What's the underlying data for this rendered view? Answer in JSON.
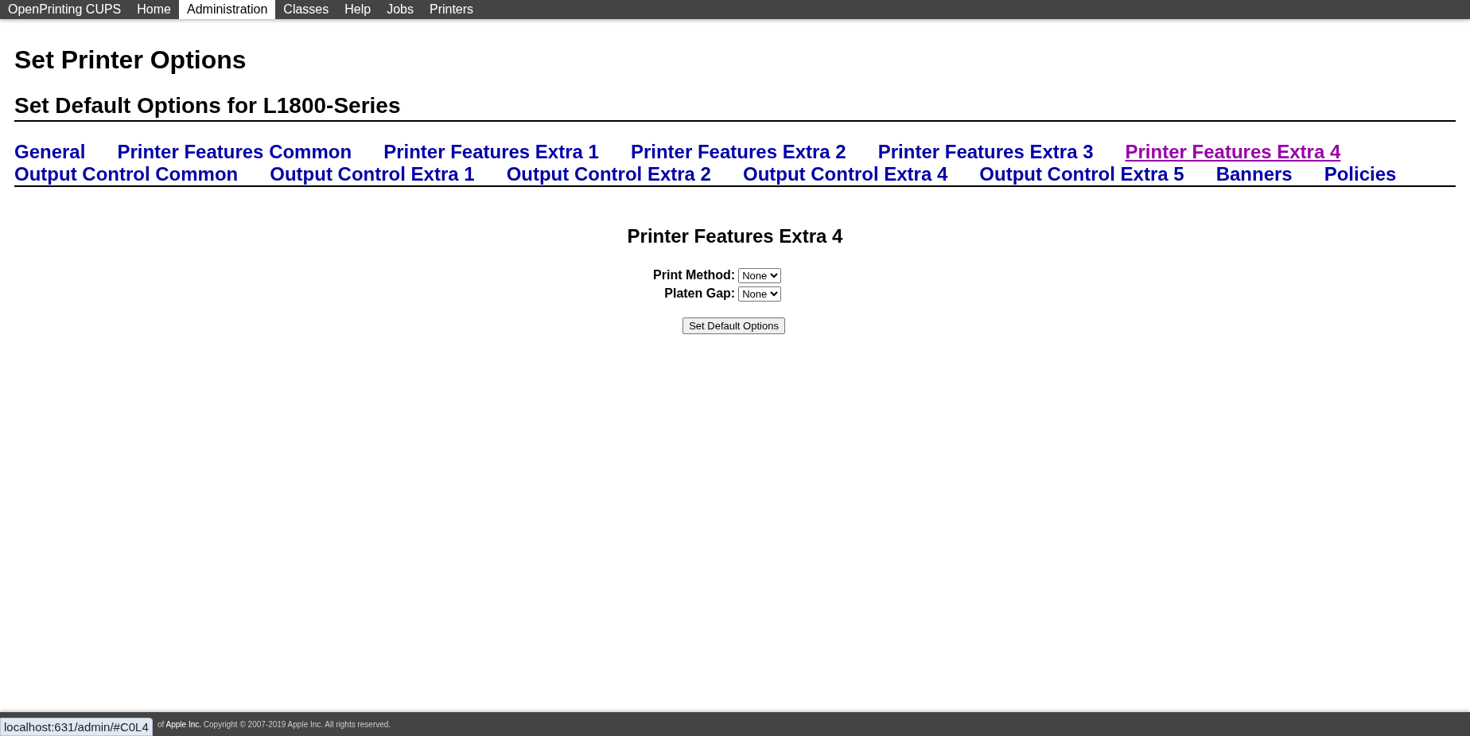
{
  "nav": [
    {
      "label": "OpenPrinting CUPS",
      "selected": false
    },
    {
      "label": "Home",
      "selected": false
    },
    {
      "label": "Administration",
      "selected": true
    },
    {
      "label": "Classes",
      "selected": false
    },
    {
      "label": "Help",
      "selected": false
    },
    {
      "label": "Jobs",
      "selected": false
    },
    {
      "label": "Printers",
      "selected": false
    }
  ],
  "title": "Set Printer Options",
  "subtitle": "Set Default Options for L1800-Series",
  "tabs": [
    {
      "label": "General",
      "selected": false
    },
    {
      "label": "Printer Features Common",
      "selected": false
    },
    {
      "label": "Printer Features Extra 1",
      "selected": false
    },
    {
      "label": "Printer Features Extra 2",
      "selected": false
    },
    {
      "label": "Printer Features Extra 3",
      "selected": false
    },
    {
      "label": "Printer Features Extra 4",
      "selected": true
    },
    {
      "label": "Output Control Common",
      "selected": false
    },
    {
      "label": "Output Control Extra 1",
      "selected": false
    },
    {
      "label": "Output Control Extra 2",
      "selected": false
    },
    {
      "label": "Output Control Extra 4",
      "selected": false
    },
    {
      "label": "Output Control Extra 5",
      "selected": false
    },
    {
      "label": "Banners",
      "selected": false
    },
    {
      "label": "Policies",
      "selected": false
    }
  ],
  "section_title": "Printer Features Extra 4",
  "options": [
    {
      "label": "Print Method:",
      "value": "None"
    },
    {
      "label": "Platen Gap:",
      "value": "None"
    }
  ],
  "submit": "Set Default Options",
  "footer": "of **Apple Inc.** Copyright © 2007-2019 Apple Inc. All rights reserved.",
  "status_url": "localhost:631/admin/#C0L4"
}
